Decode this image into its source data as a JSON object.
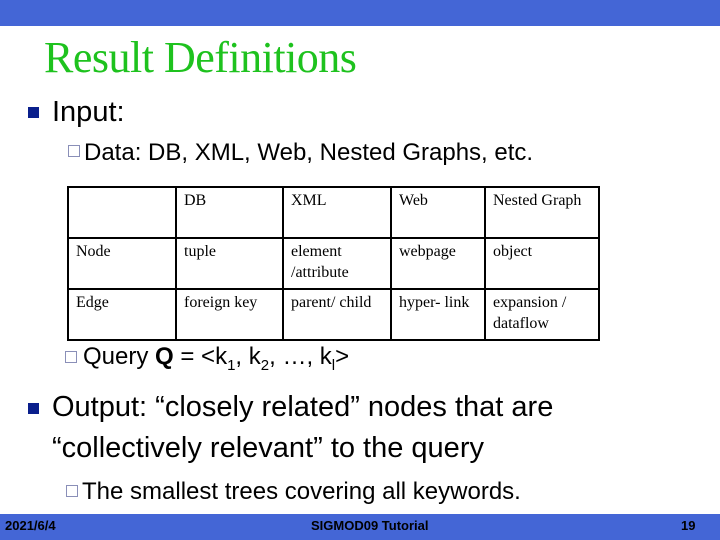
{
  "slide": {
    "title": "Result Definitions",
    "input_label": "Input:",
    "data_line": "Data: DB, XML, Web, Nested Graphs, etc.",
    "table": {
      "headers": [
        "",
        "DB",
        "XML",
        "Web",
        "Nested Graph"
      ],
      "rows": [
        {
          "label": "Node",
          "cells": [
            "tuple",
            "element /attribute",
            "webpage",
            "object"
          ]
        },
        {
          "label": "Edge",
          "cells": [
            "foreign key",
            "parent/ child",
            "hyper- link",
            "expansion / dataflow"
          ]
        }
      ]
    },
    "query": {
      "prefix": "Query ",
      "symbol": "Q",
      "eq": " = <k",
      "s1": "1",
      "mid1": ", k",
      "s2": "2",
      "mid2": ", …, k",
      "s3": "l",
      "end": ">"
    },
    "output_line1": "Output:  “closely related” nodes that are",
    "output_line2": "“collectively relevant” to the query",
    "output_sub": "The smallest trees covering all keywords."
  },
  "footer": {
    "date": "2021/6/4",
    "center": "SIGMOD09 Tutorial",
    "page": "19"
  },
  "colors": {
    "bar": "#4466d6",
    "title": "#1ec21e",
    "bullet": "#0a1f8c"
  }
}
